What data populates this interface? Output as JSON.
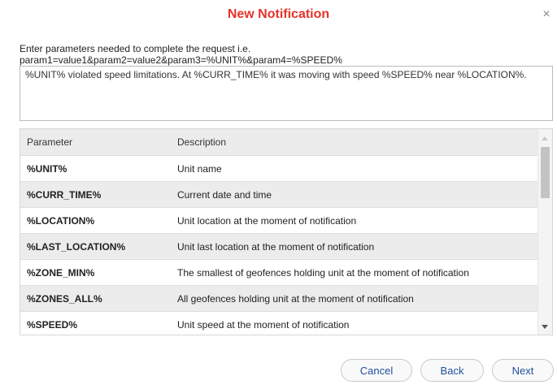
{
  "dialog": {
    "title": "New Notification",
    "close_symbol": "×",
    "instructions_line1": "Enter parameters needed to complete the request i.e.",
    "instructions_line2": "param1=value1&param2=value2&param3=%UNIT%&param4=%SPEED%",
    "message_text": "%UNIT% violated speed limitations. At %CURR_TIME% it was moving with speed %SPEED% near %LOCATION%."
  },
  "table": {
    "headers": [
      "Parameter",
      "Description"
    ],
    "rows": [
      {
        "param": "%UNIT%",
        "desc": "Unit name"
      },
      {
        "param": "%CURR_TIME%",
        "desc": "Current date and time"
      },
      {
        "param": "%LOCATION%",
        "desc": "Unit location at the moment of notification"
      },
      {
        "param": "%LAST_LOCATION%",
        "desc": "Unit last location at the moment of notification"
      },
      {
        "param": "%ZONE_MIN%",
        "desc": "The smallest of geofences holding unit at the moment of notification"
      },
      {
        "param": "%ZONES_ALL%",
        "desc": "All geofences holding unit at the moment of notification"
      },
      {
        "param": "%SPEED%",
        "desc": "Unit speed at the moment of notification"
      },
      {
        "param": "",
        "desc": ""
      }
    ]
  },
  "buttons": {
    "cancel": "Cancel",
    "back": "Back",
    "next": "Next"
  },
  "colors": {
    "title": "#e5332a",
    "button_text": "#1f4f9a",
    "row_alt": "#ececec"
  },
  "icons": {
    "close": "close-icon",
    "scroll_up": "arrow-up-icon",
    "scroll_down": "arrow-down-icon"
  }
}
